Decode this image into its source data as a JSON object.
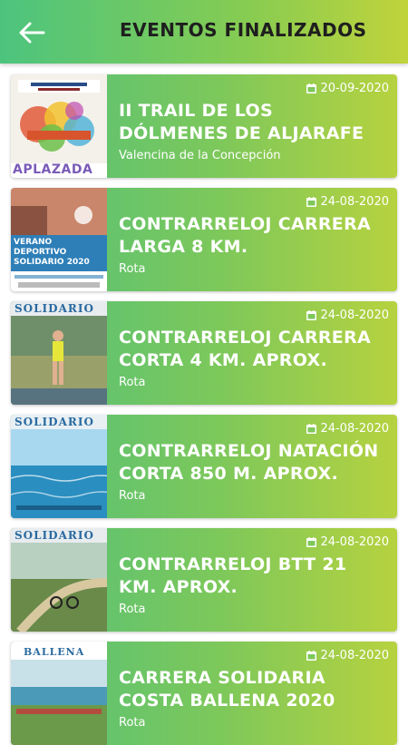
{
  "header": {
    "title": "EVENTOS FINALIZADOS",
    "back_icon": "arrow-left-icon"
  },
  "colors": {
    "accent_start": "#4cc47e",
    "accent_end": "#c0d33b",
    "text": "#ffffff"
  },
  "events": [
    {
      "date": "20-09-2020",
      "title": "II TRAIL DE LOS DÓLMENES DE ALJARAFE",
      "location": "Valencina de la Concepción",
      "poster_text": "APLAZADA"
    },
    {
      "date": "24-08-2020",
      "title": "CONTRARRELOJ CARRERA LARGA 8 KM.",
      "location": "Rota",
      "poster_text": "VERANO DEPORTIVO SOLIDARIO 2020"
    },
    {
      "date": "24-08-2020",
      "title": "CONTRARRELOJ CARRERA CORTA 4 KM. APROX.",
      "location": "Rota",
      "poster_text": "SOLIDARIO"
    },
    {
      "date": "24-08-2020",
      "title": "CONTRARRELOJ NATACIÓN CORTA 850 M. APROX.",
      "location": "Rota",
      "poster_text": "SOLIDARIO"
    },
    {
      "date": "24-08-2020",
      "title": "CONTRARRELOJ BTT 21 KM. APROX.",
      "location": "Rota",
      "poster_text": "SOLIDARIO"
    },
    {
      "date": "24-08-2020",
      "title": "CARRERA SOLIDARIA COSTA BALLENA 2020",
      "location": "Rota",
      "poster_text": "BALLENA"
    }
  ]
}
